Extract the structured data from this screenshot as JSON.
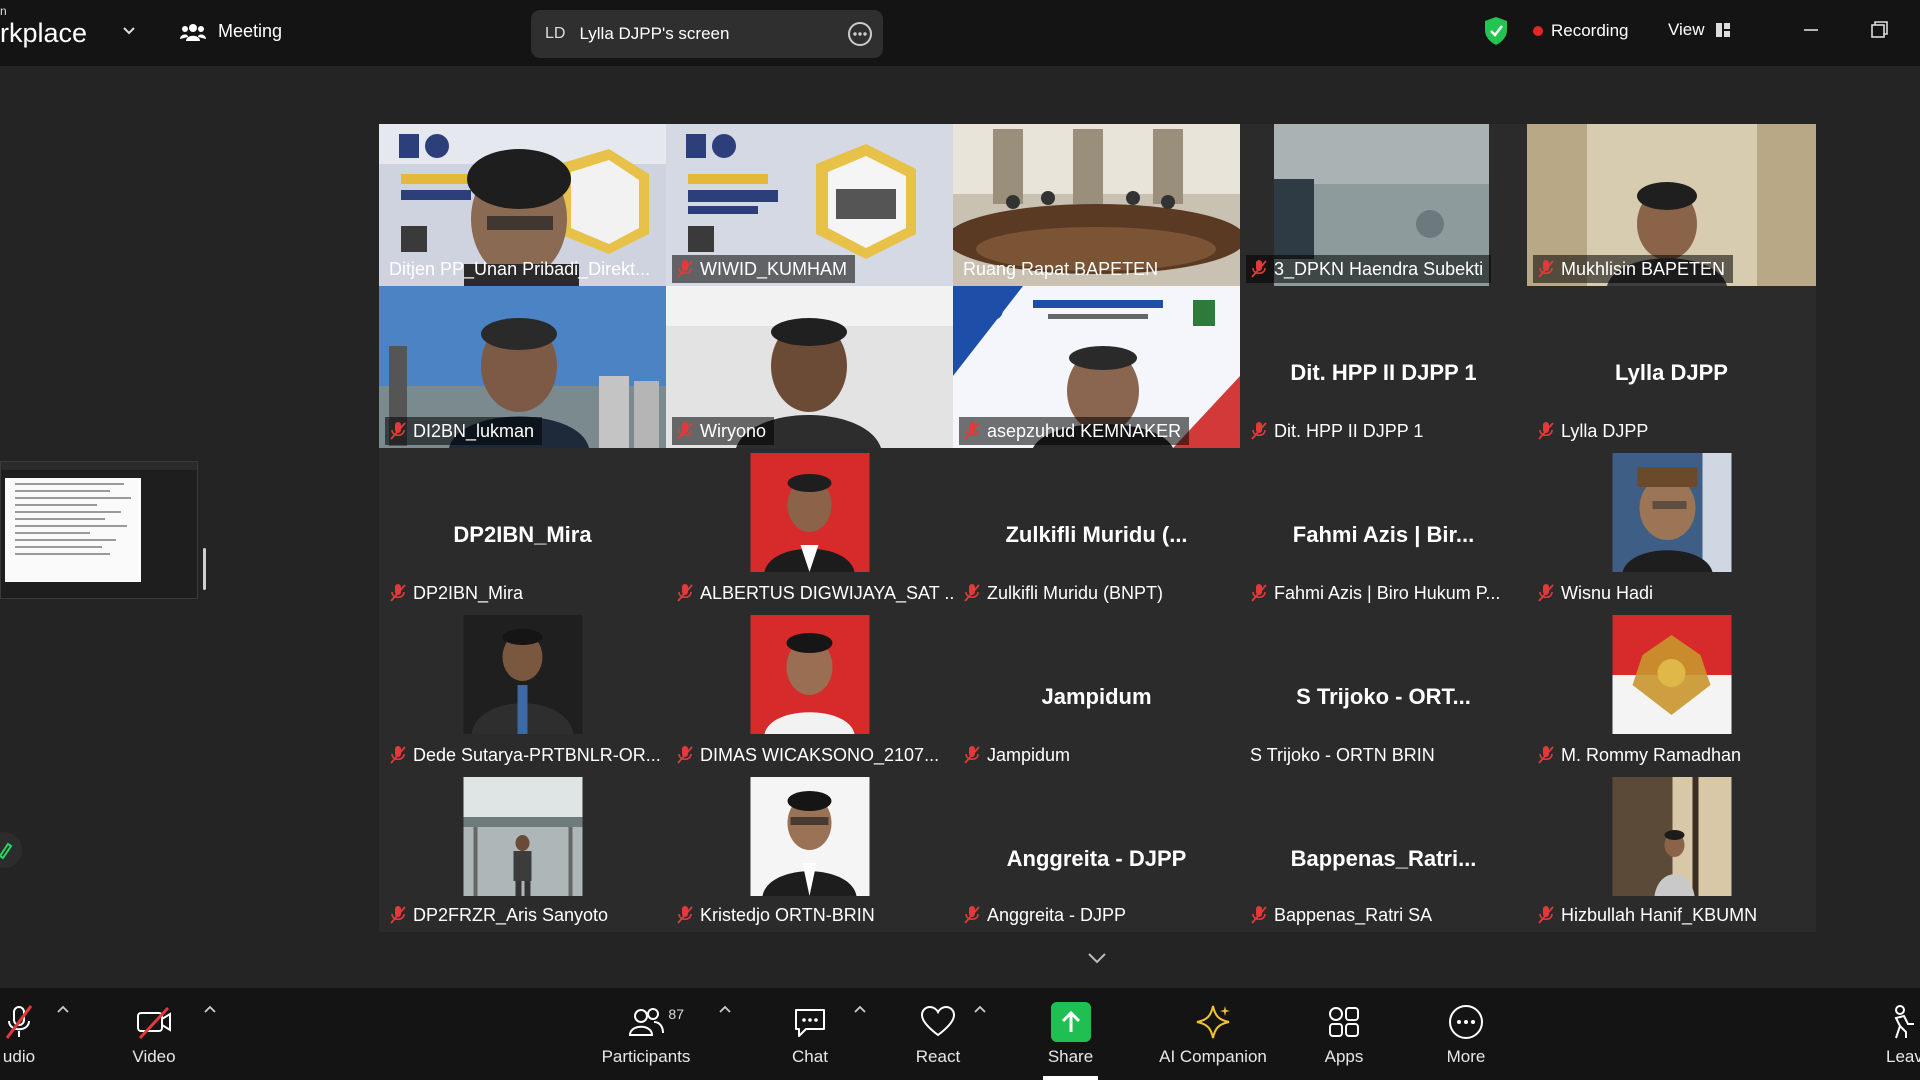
{
  "window": {
    "app_title_top": "n",
    "app_title": "rkplace",
    "meeting_label": "Meeting",
    "share_initials": "LD",
    "share_label": "Lylla DJPP's screen",
    "recording_label": "Recording",
    "view_label": "View",
    "recording_color": "#e02828",
    "active_speaker_color": "#23d962"
  },
  "tiles": [
    {
      "name": "Ditjen PP_Unan Pribadi_Direkt...",
      "type": "video",
      "active": true,
      "muted": false
    },
    {
      "name": "WIWID_KUMHAM",
      "type": "video",
      "muted": true
    },
    {
      "name": "Ruang Rapat BAPETEN",
      "type": "video",
      "muted": false
    },
    {
      "name": "3_DPKN Haendra Subekti",
      "type": "video",
      "muted": true
    },
    {
      "name": "Mukhlisin BAPETEN",
      "type": "video",
      "muted": true
    },
    {
      "name": "DI2BN_lukman",
      "type": "video",
      "muted": true
    },
    {
      "name": "Wiryono",
      "type": "video",
      "muted": true
    },
    {
      "name": "asepzuhud KEMNAKER",
      "type": "video",
      "muted": true
    },
    {
      "name": "Dit. HPP II DJPP 1",
      "center": "Dit. HPP II DJPP 1",
      "type": "name",
      "muted": true
    },
    {
      "name": "Lylla DJPP",
      "center": "Lylla DJPP",
      "type": "name",
      "muted": true
    },
    {
      "name": "DP2IBN_Mira",
      "center": "DP2IBN_Mira",
      "type": "name",
      "muted": true
    },
    {
      "name": "ALBERTUS DIGWIJAYA_SAT ...",
      "type": "photo",
      "muted": true
    },
    {
      "name": "Zulkifli Muridu (BNPT)",
      "center": "Zulkifli  Muridu  (...",
      "type": "name",
      "muted": true
    },
    {
      "name": "Fahmi Azis | Biro Hukum P...",
      "center": "Fahmi Azis | Bir...",
      "type": "name",
      "muted": true
    },
    {
      "name": "Wisnu Hadi",
      "type": "photo",
      "muted": true
    },
    {
      "name": "Dede Sutarya-PRTBNLR-OR...",
      "type": "photo",
      "muted": true
    },
    {
      "name": "DIMAS WICAKSONO_2107...",
      "type": "photo",
      "muted": true
    },
    {
      "name": "Jampidum",
      "center": "Jampidum",
      "type": "name",
      "muted": true
    },
    {
      "name": "S Trijoko - ORTN BRIN",
      "center": "S Trijoko - ORT...",
      "type": "name",
      "muted": false
    },
    {
      "name": "M. Rommy Ramadhan",
      "type": "photo",
      "muted": true
    },
    {
      "name": "DP2FRZR_Aris Sanyoto",
      "type": "photo",
      "muted": true
    },
    {
      "name": "Kristedjo ORTN-BRIN",
      "type": "photo",
      "muted": true
    },
    {
      "name": "Anggreita - DJPP",
      "center": "Anggreita - DJPP",
      "type": "name",
      "muted": true
    },
    {
      "name": "Bappenas_Ratri SA",
      "center": "Bappenas_Ratri...",
      "type": "name",
      "muted": true
    },
    {
      "name": "Hizbullah Hanif_KBUMN",
      "type": "photo",
      "muted": true
    }
  ],
  "toolbar": {
    "audio": "udio",
    "video": "Video",
    "participants": "Participants",
    "participants_count": "87",
    "chat": "Chat",
    "react": "React",
    "share": "Share",
    "ai_companion": "AI Companion",
    "apps": "Apps",
    "more": "More",
    "leave": "Leav"
  }
}
